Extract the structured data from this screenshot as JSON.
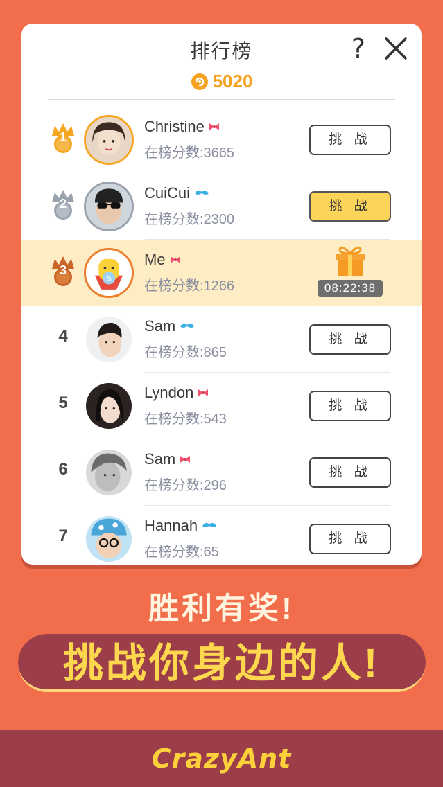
{
  "header": {
    "title": "排行榜",
    "help_label": "?",
    "coins": "5020"
  },
  "leaderboard": [
    {
      "rank": "1",
      "name": "Christine",
      "gender": "female",
      "score": "在榜分数:3665",
      "action": "挑 战"
    },
    {
      "rank": "2",
      "name": "CuiCui",
      "gender": "male",
      "score": "在榜分数:2300",
      "action": "挑 战"
    },
    {
      "rank": "3",
      "name": "Me",
      "gender": "female",
      "score": "在榜分数:1266",
      "timer": "08:22:38"
    },
    {
      "rank": "4",
      "name": "Sam",
      "gender": "male",
      "score": "在榜分数:865",
      "action": "挑 战"
    },
    {
      "rank": "5",
      "name": "Lyndon",
      "gender": "female",
      "score": "在榜分数:543",
      "action": "挑 战"
    },
    {
      "rank": "6",
      "name": "Sam",
      "gender": "female",
      "score": "在榜分数:296",
      "action": "挑 战"
    },
    {
      "rank": "7",
      "name": "Hannah",
      "gender": "male",
      "score": "在榜分数:65",
      "action": "挑 战"
    }
  ],
  "promo": {
    "line1": "胜利有奖!",
    "line2": "挑战你身边的人!"
  },
  "footer": {
    "brand": "CrazyAnt"
  },
  "colors": {
    "background": "#f26d4b",
    "banner": "#9c3d4a",
    "accent_yellow": "#fdd45a",
    "gold": "#f5a623",
    "silver": "#9aa3ad",
    "bronze": "#ec7e2e",
    "male_icon": "#3ab0e6",
    "female_icon": "#f0506e"
  }
}
